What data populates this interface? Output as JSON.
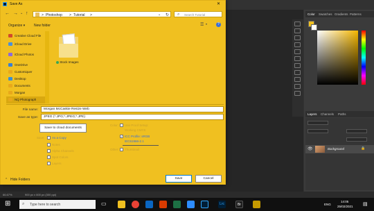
{
  "dialog": {
    "title": "Save As",
    "nav": {
      "back": "←",
      "forward": "→",
      "up": "↑",
      "dropdown": "⌄",
      "refresh": "↻"
    },
    "breadcrumb": [
      ">",
      "Photoshop",
      ">",
      "Tutorial",
      ">"
    ],
    "search_placeholder": "Search Tutorial",
    "toolbar": {
      "organize": "Organize ▾",
      "new_folder": "New folder"
    },
    "sidebar": [
      {
        "label": "Creative Cloud File",
        "color": "#d24a2b"
      },
      {
        "label": "iCloud Drive",
        "color": "#4a90d9"
      },
      {
        "label": "iCloud Photos",
        "color": "#8a6cd9"
      },
      {
        "label": "OneDrive",
        "color": "#3a7fd4"
      },
      {
        "label": "Customiquer",
        "color": "#e8a81a"
      },
      {
        "label": "Desktop",
        "color": "#3a8fd4"
      },
      {
        "label": "Documents",
        "color": "#e8a81a"
      },
      {
        "label": "Morgan",
        "color": "#e8a81a"
      },
      {
        "label": "NQ Photograph",
        "color": "#e8a81a"
      }
    ],
    "folder": {
      "label": "Stock Images"
    },
    "file_name_label": "File name:",
    "file_name_value": "Morgan McCaskie Resize Web",
    "save_type_label": "Save as type:",
    "save_type_value": "JPEG (*.JPG;*.JPEG;*.JPE)",
    "save_cloud_button": "Save to cloud documents",
    "save_label": "Save:",
    "save_options": [
      "As a Copy",
      "Notes",
      "Alpha Channels",
      "Spot Colors",
      "Layers"
    ],
    "color_label": "Color:",
    "color_options": [
      "Use Proof Setup:",
      "Working CMYK"
    ],
    "icc_label": "ICC Profile: sRGB",
    "icc_label2": "IEC61966-2.1",
    "other_label": "Other:",
    "other_option": "Thumbnail",
    "hide_folders": "Hide Folders",
    "save_button": "Save",
    "cancel_button": "Cancel"
  },
  "photoshop": {
    "panel_tabs": [
      "Color",
      "Swatches",
      "Gradients",
      "Patterns"
    ],
    "layers_tabs": [
      "Layers",
      "Channels",
      "Paths"
    ],
    "layer_name": "Background",
    "status_zoom": "66.67%",
    "status_doc": "900 px x 600 px (300 ppi)"
  },
  "taskbar": {
    "search_placeholder": "Type here to search",
    "time": "14:05",
    "date": "25/02/2021",
    "lang": "ENG",
    "app_labels": [
      "Lrc",
      "Br"
    ]
  }
}
